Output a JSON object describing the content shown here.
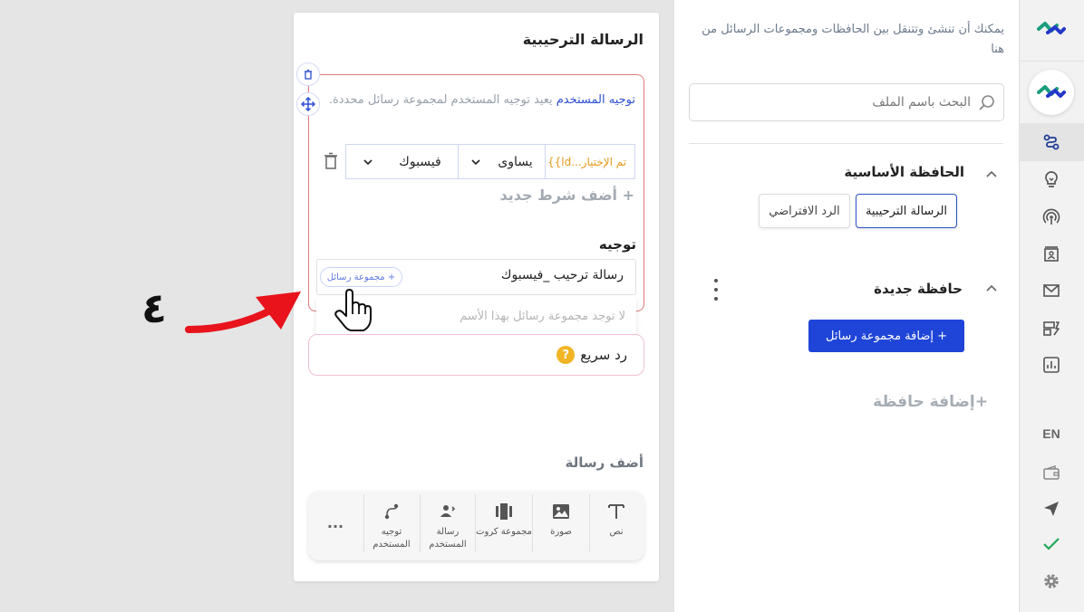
{
  "colors": {
    "brand_blue": "#1f45d8",
    "link_blue": "#2d4fd0",
    "error_red": "#e27a7a",
    "variable_orange": "#e39a1c",
    "annotation_red": "#e8131b"
  },
  "rail": {
    "language": "EN",
    "icons": [
      "logo-icon",
      "flow-icon",
      "bulb-icon",
      "broadcast-icon",
      "contact-card-icon",
      "mail-icon",
      "templates-icon",
      "analytics-icon",
      "wallet-icon",
      "send-icon",
      "check-icon",
      "settings-icon"
    ]
  },
  "sidebar": {
    "description": "يمكنك أن تنشئ وتتنقل بين الحافظات ومجموعات الرسائل من هنا",
    "search_placeholder": "البحث باسم الملف",
    "main_folder": {
      "title": "الحافظة الأساسية",
      "chips": [
        {
          "label": "الرسالة الترحيبية",
          "active": true
        },
        {
          "label": "الرد الافتراضي",
          "active": false
        }
      ]
    },
    "new_folder": {
      "title": "حافظة جديدة",
      "add_group_label": "+ إضافة مجموعة رسائل"
    },
    "add_folder_label": "+إضافة حافظة"
  },
  "editor": {
    "title": "الرسالة الترحيبية",
    "redirect_block": {
      "description_highlight": "توجيه المستخدم",
      "description_rest": " يعيد توجيه المستخدم لمجموعة رسائل محددة.",
      "condition": {
        "variable": "{{ld...تم الإختيار",
        "operator": "يساوى",
        "value": "فيسبوك"
      },
      "add_condition_label": "+ أضف شرط جديد",
      "redirect_label": "توجيه",
      "redirect_value": "رسالة ترحيب _فيسبوك",
      "group_badge": "+ مجموعة رسائل",
      "empty_dropdown": "لا توجد مجموعة رسائل بهذا الأسم"
    },
    "quick_reply": {
      "label": "رد سريع",
      "icon_glyph": "?"
    },
    "add_message_title": "أضف رسالة",
    "toolbar": {
      "items": [
        {
          "label": "نص",
          "icon": "text-icon"
        },
        {
          "label": "صورة",
          "icon": "image-icon"
        },
        {
          "label": "مجموعة كروت",
          "icon": "cards-icon"
        },
        {
          "label": "رسالة المستخدم",
          "icon": "user-message-icon"
        },
        {
          "label": "توجيه المستخدم",
          "icon": "redirect-icon"
        }
      ],
      "more_label": "..."
    }
  },
  "annotation": {
    "step_number": "٤"
  }
}
